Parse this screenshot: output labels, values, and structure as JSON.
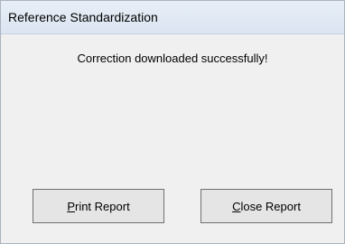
{
  "window": {
    "title": "Reference Standardization"
  },
  "message": "Correction downloaded successfully!",
  "buttons": {
    "print": {
      "mnemonic": "P",
      "rest": "rint Report"
    },
    "close": {
      "mnemonic": "C",
      "rest": "lose Report"
    }
  }
}
